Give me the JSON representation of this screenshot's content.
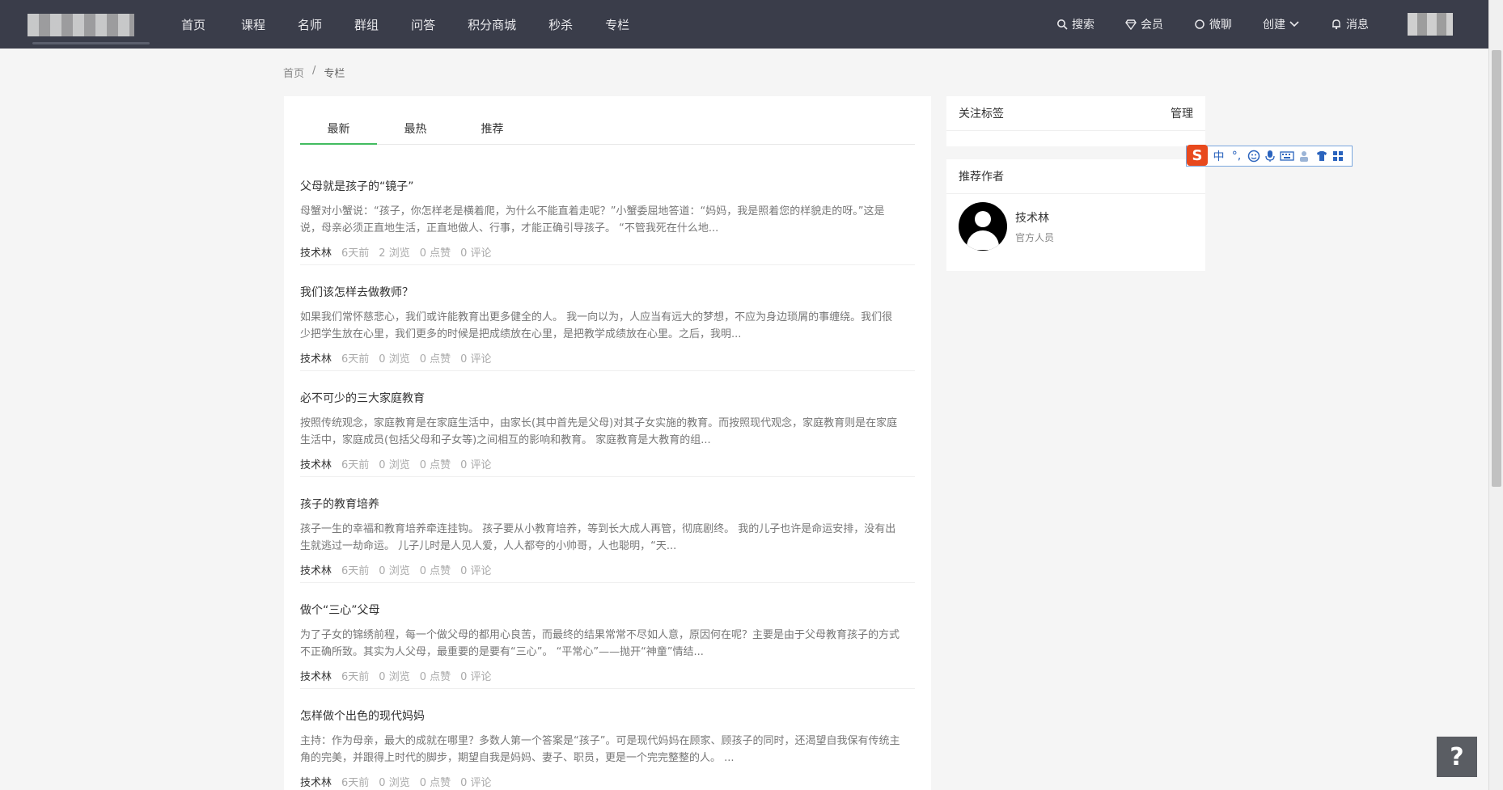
{
  "nav": {
    "items": [
      "首页",
      "课程",
      "名师",
      "群组",
      "问答",
      "积分商城",
      "秒杀",
      "专栏"
    ]
  },
  "right_nav": {
    "search": "搜索",
    "vip": "会员",
    "chat": "微聊",
    "create": "创建",
    "messages": "消息"
  },
  "breadcrumb": {
    "home": "首页",
    "separator": "/",
    "current": "专栏"
  },
  "tabs": [
    "最新",
    "最热",
    "推荐"
  ],
  "articles": [
    {
      "title": "父母就是孩子的“镜子”",
      "summary": "母蟹对小蟹说：“孩子，你怎样老是横着爬，为什么不能直着走呢？”小蟹委屈地答道：“妈妈，我是照着您的样貌走的呀。”这是说，母亲必须正直地生活，正直地做人、行事，才能正确引导孩子。          “不管我死在什么地...",
      "author": "技术林",
      "time": "6天前",
      "views": "2 浏览",
      "likes": "0 点赞",
      "comments": "0 评论"
    },
    {
      "title": "我们该怎样去做教师？",
      "summary": "如果我们常怀慈悲心，我们或许能教育出更多健全的人。          我一向以为，人应当有远大的梦想，不应为身边琐屑的事缠绕。我们很少把学生放在心里，我们更多的时候是把成绩放在心里，是把教学成绩放在心里。之后，我明...",
      "author": "技术林",
      "time": "6天前",
      "views": "0 浏览",
      "likes": "0 点赞",
      "comments": "0 评论"
    },
    {
      "title": "必不可少的三大家庭教育",
      "summary": "按照传统观念，家庭教育是在家庭生活中，由家长(其中首先是父母)对其子女实施的教育。而按照现代观念，家庭教育则是在家庭生活中，家庭成员(包括父母和子女等)之间相互的影响和教育。          家庭教育是大教育的组...",
      "author": "技术林",
      "time": "6天前",
      "views": "0 浏览",
      "likes": "0 点赞",
      "comments": "0 评论"
    },
    {
      "title": "孩子的教育培养",
      "summary": "孩子一生的幸福和教育培养牵连挂钩。          孩子要从小教育培养，等到长大成人再管，彻底剧终。          我的儿子也许是命运安排，没有出生就逃过一劫命运。          儿子儿时是人见人爱，人人都夸的小帅哥，人也聪明，“天...",
      "author": "技术林",
      "time": "6天前",
      "views": "0 浏览",
      "likes": "0 点赞",
      "comments": "0 评论"
    },
    {
      "title": "做个“三心”父母",
      "summary": "为了子女的锦绣前程，每一个做父母的都用心良苦，而最终的结果常常不尽如人意，原因何在呢？主要是由于父母教育孩子的方式不正确所致。其实为人父母，最重要的是要有“三心”。          “平常心”——抛开“神童”情结...",
      "author": "技术林",
      "time": "6天前",
      "views": "0 浏览",
      "likes": "0 点赞",
      "comments": "0 评论"
    },
    {
      "title": "怎样做个出色的现代妈妈",
      "summary": "主持：作为母亲，最大的成就在哪里？多数人第一个答案是“孩子”。可是现代妈妈在顾家、顾孩子的同时，还渴望自我保有传统主角的完美，并跟得上时代的脚步，期望自我是妈妈、妻子、职员，更是一个完完整整的人。      ...",
      "author": "技术林",
      "time": "6天前",
      "views": "0 浏览",
      "likes": "0 点赞",
      "comments": "0 评论"
    }
  ],
  "tags_panel": {
    "title": "关注标签",
    "manage": "管理"
  },
  "authors_panel": {
    "title": "推荐作者",
    "author_name": "技术林",
    "author_role": "官方人员"
  },
  "ime": {
    "logo": "S",
    "mode": "中",
    "punct": "°,"
  },
  "help": "?"
}
